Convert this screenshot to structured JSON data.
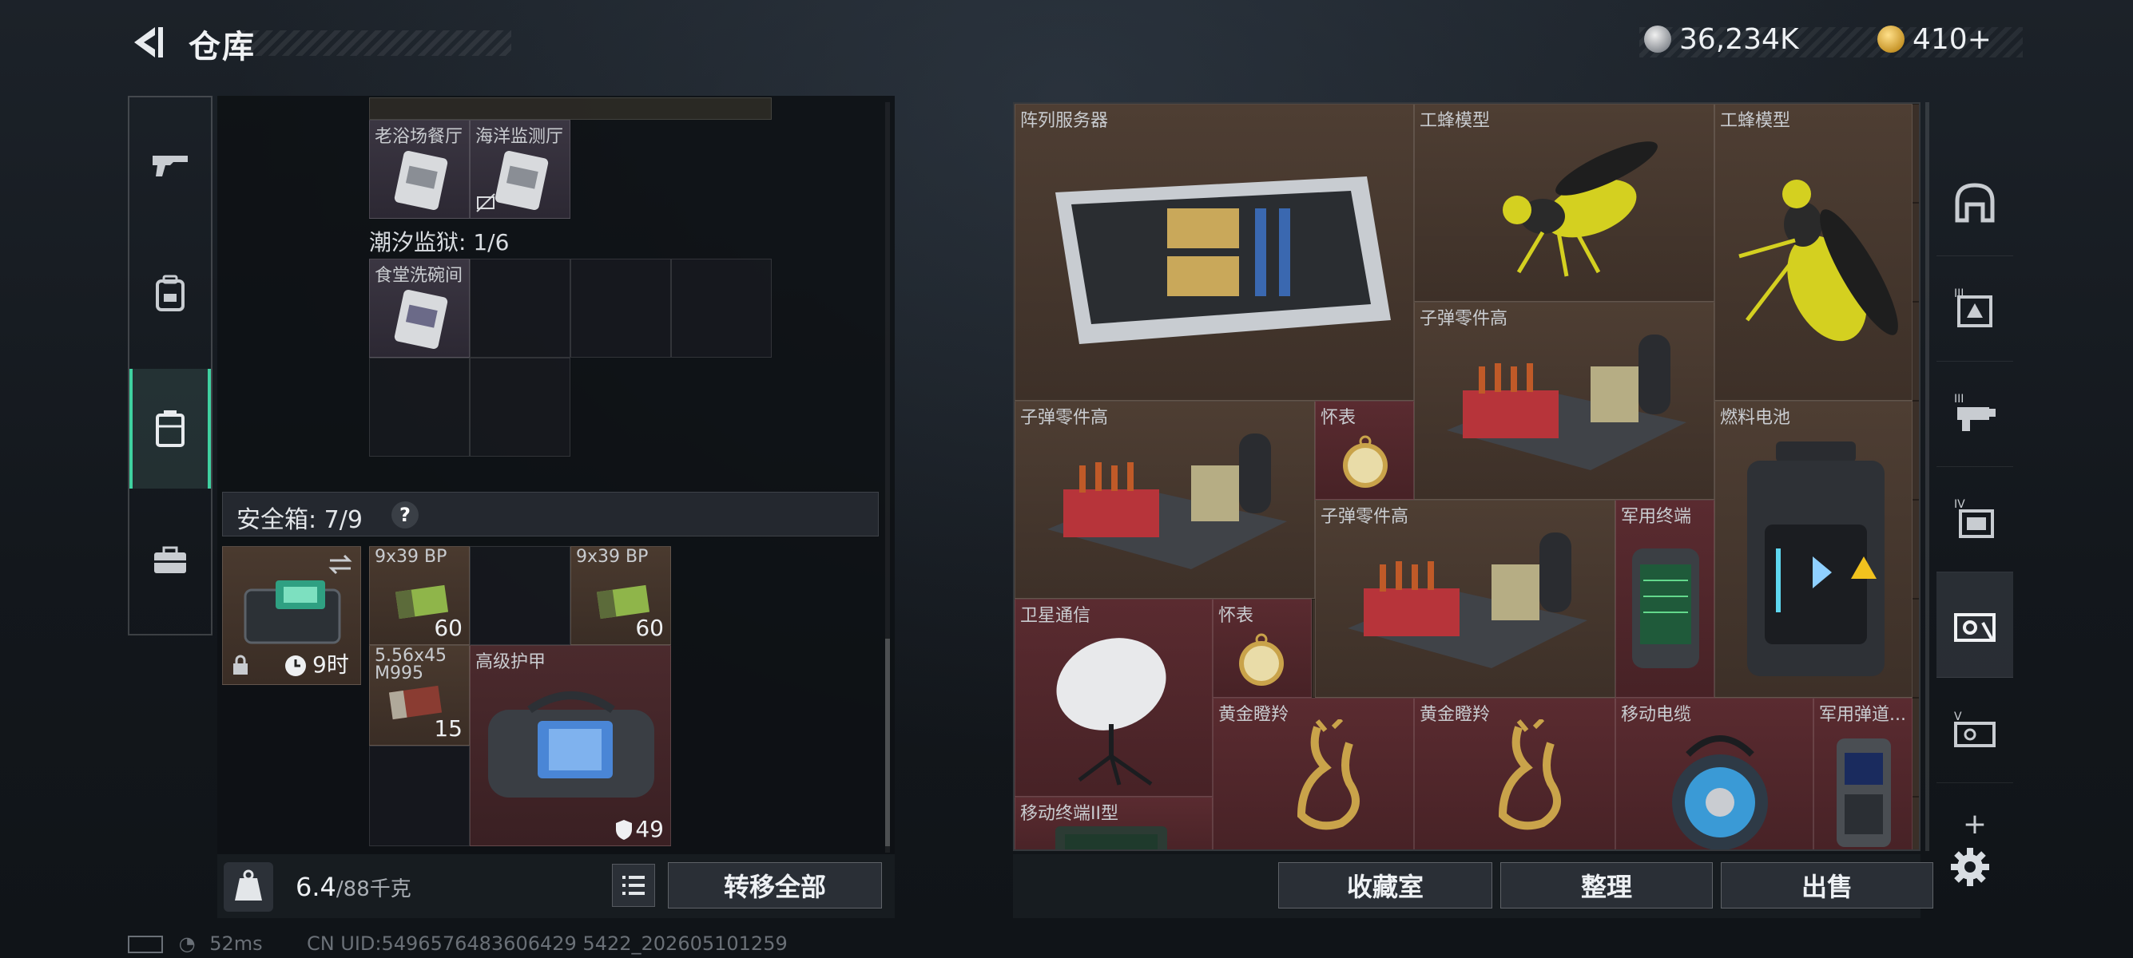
{
  "header": {
    "title": "仓库",
    "currency_silver": "36,234K",
    "currency_gold": "410+"
  },
  "left_sidebar": {
    "items": [
      {
        "icon": "gun-icon"
      },
      {
        "icon": "backpack-icon"
      },
      {
        "icon": "container-icon",
        "active": true
      },
      {
        "icon": "briefcase-icon"
      }
    ]
  },
  "storage": {
    "top_items": [
      {
        "name": "老浴场餐厅"
      },
      {
        "name": "海洋监测厅"
      }
    ],
    "tide_prison_label": "潮汐监狱: 1/6",
    "tide_items": [
      {
        "name": "食堂洗碗间"
      }
    ],
    "safe_box_label": "安全箱: 7/9",
    "safe_box_help": "?",
    "safe_box_timer": "9时",
    "safe_items": [
      {
        "name": "9x39 BP",
        "qty": "60"
      },
      {
        "name": "9x39 BP",
        "qty": "60"
      },
      {
        "name": "5.56x45 M995",
        "qty": "15"
      },
      {
        "name": "高级护甲",
        "qty": "49"
      }
    ]
  },
  "bottom_bar": {
    "weight_value": "6.4",
    "weight_max": "/88千克",
    "transfer_all": "转移全部",
    "collection": "收藏室",
    "organize": "整理",
    "sell": "出售"
  },
  "loot_grid": {
    "items": [
      {
        "name": "阵列服务器",
        "color": "brown"
      },
      {
        "name": "工蜂模型",
        "color": "brown"
      },
      {
        "name": "工蜂模型",
        "color": "brown"
      },
      {
        "name": "子弹零件高",
        "color": "brown"
      },
      {
        "name": "子弹零件高",
        "color": "brown"
      },
      {
        "name": "怀表",
        "color": "red"
      },
      {
        "name": "燃料电池",
        "color": "brown"
      },
      {
        "name": "子弹零件高",
        "color": "brown"
      },
      {
        "name": "军用终端",
        "color": "red"
      },
      {
        "name": "卫星通信",
        "color": "red"
      },
      {
        "name": "怀表",
        "color": "red"
      },
      {
        "name": "黄金瞪羚",
        "color": "red"
      },
      {
        "name": "黄金瞪羚",
        "color": "red"
      },
      {
        "name": "移动电缆",
        "color": "red"
      },
      {
        "name": "军用弹道...",
        "color": "red"
      },
      {
        "name": "移动终端II型",
        "color": "red"
      }
    ]
  },
  "right_tabs": {
    "items": [
      {
        "icon": "arch-icon"
      },
      {
        "icon": "tier-3-icon",
        "label": "III"
      },
      {
        "icon": "tier-3b-icon",
        "label": "III"
      },
      {
        "icon": "tier-4-icon",
        "label": "IV"
      },
      {
        "icon": "tier-box-icon",
        "active": true
      },
      {
        "icon": "tier-5-icon",
        "label": "V"
      }
    ],
    "add": "+"
  },
  "status": {
    "ping": "52ms",
    "uid": "CN UID:5496576483606429 5422_202605101259"
  },
  "colors": {
    "accent": "#3fd1a0",
    "brown_rarity": "#4e3e33",
    "red_rarity": "#5a2b30",
    "purple_rarity": "#3b3642"
  }
}
